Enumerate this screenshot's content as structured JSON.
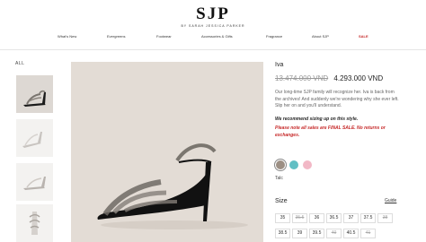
{
  "header": {
    "logo": "SJP",
    "logo_tagline": "BY SARAH JESSICA PARKER"
  },
  "nav": {
    "items": [
      "What's New",
      "Evergreens",
      "Footwear",
      "Accessories & Gifts",
      "Fragrance",
      "About SJP",
      "SALE"
    ]
  },
  "gallery": {
    "all_label": "ALL"
  },
  "product": {
    "name": "Iva",
    "price_old": "13.474.000 VND",
    "price_new": "4.293.000 VND",
    "description": "Our long-time SJP family will recognize her. Iva is back from the archives! And suddenly we're wondering why she ever left. Slip her on and you'll understand.",
    "sizing_note": "We recommend sizing up on this style.",
    "final_sale_note": "Please note all sales are FINAL SALE. No returns or exchanges.",
    "colors": [
      {
        "name": "Talc",
        "hex": "#9c8f84",
        "selected": true
      },
      {
        "name": "Teal",
        "hex": "#62bfc4",
        "selected": false
      },
      {
        "name": "Pink",
        "hex": "#f2b8c6",
        "selected": false
      }
    ],
    "selected_color_label": "Talc",
    "size_label": "Size",
    "size_guide_label": "Guide",
    "sizes": [
      {
        "label": "35",
        "available": true
      },
      {
        "label": "35.5",
        "available": false
      },
      {
        "label": "36",
        "available": true
      },
      {
        "label": "36.5",
        "available": true
      },
      {
        "label": "37",
        "available": true
      },
      {
        "label": "37.5",
        "available": true
      },
      {
        "label": "38",
        "available": false
      },
      {
        "label": "38.5",
        "available": true
      },
      {
        "label": "39",
        "available": true
      },
      {
        "label": "39.5",
        "available": true
      },
      {
        "label": "40",
        "available": false
      },
      {
        "label": "40.5",
        "available": true
      },
      {
        "label": "41",
        "available": false
      }
    ]
  }
}
